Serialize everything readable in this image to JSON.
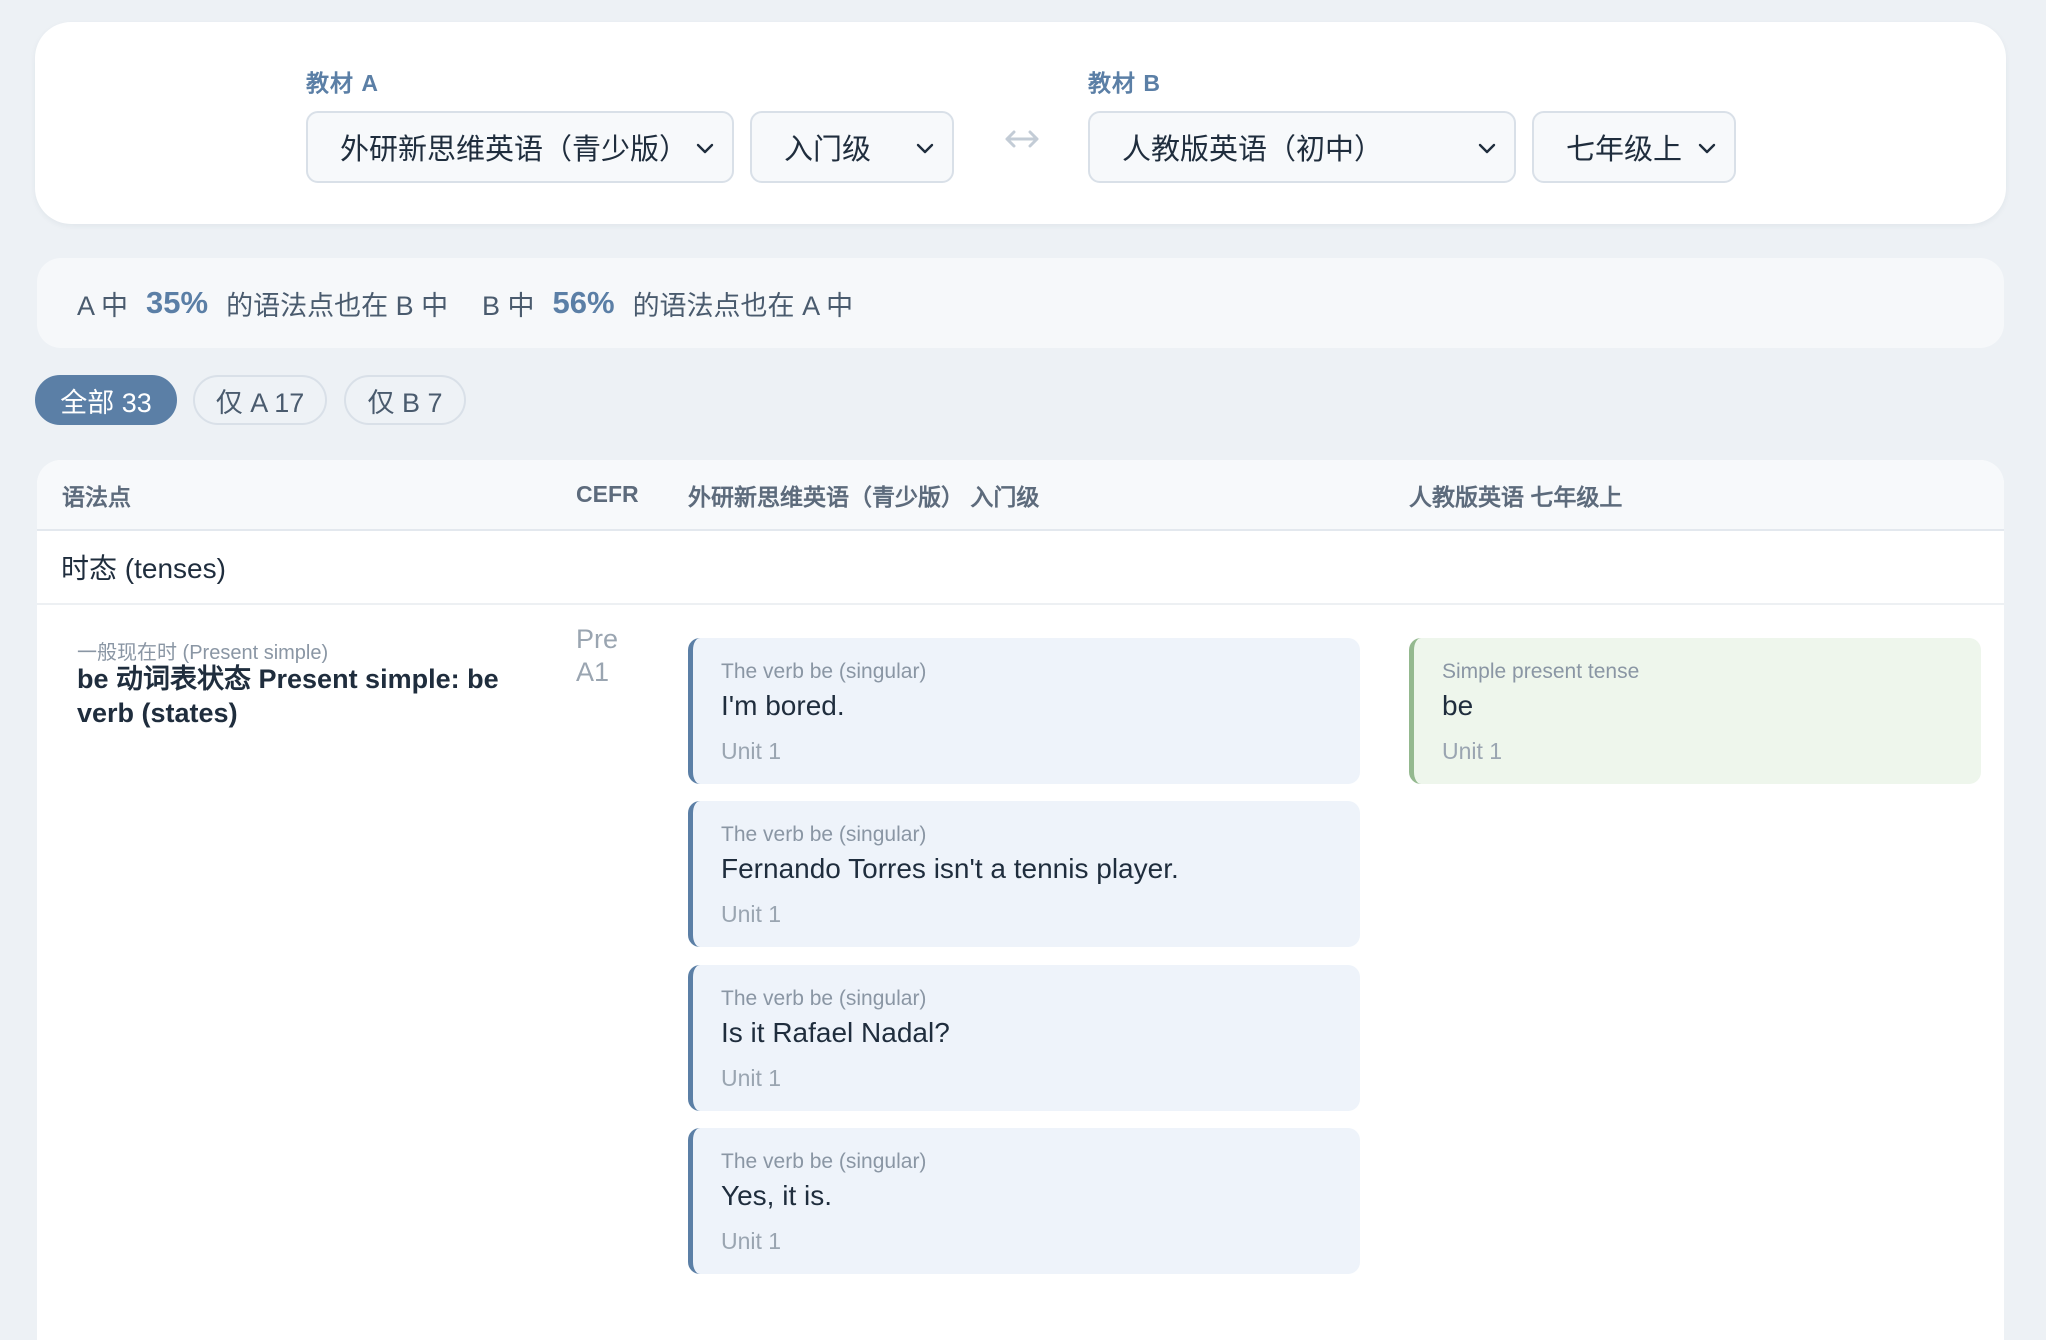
{
  "selectors": {
    "textbook_a": {
      "label": "教材 A",
      "book": "外研新思维英语（青少版）",
      "level": "入门级"
    },
    "textbook_b": {
      "label": "教材 B",
      "book": "人教版英语（初中）",
      "level": "七年级上"
    },
    "swap_icon": "swap-horizontal-icon"
  },
  "overlap": {
    "a_prefix": "A 中",
    "a_pct": "35%",
    "a_suffix": "的语法点也在 B 中",
    "b_prefix": "B 中",
    "b_pct": "56%",
    "b_suffix": "的语法点也在 A 中"
  },
  "filters": [
    {
      "label": "全部 33",
      "active": true
    },
    {
      "label": "仅 A 17",
      "active": false
    },
    {
      "label": "仅 B 7",
      "active": false
    }
  ],
  "table": {
    "headers": {
      "grammar_point": "语法点",
      "cefr": "CEFR",
      "col_a": "外研新思维英语（青少版） 入门级",
      "col_b": "人教版英语 七年级上"
    },
    "group": {
      "title": "时态 (tenses)",
      "rows": [
        {
          "sub": "一般现在时 (Present simple)",
          "main": "be 动词表状态 Present simple: be verb (states)",
          "cefr": "Pre A1",
          "a_examples": [
            {
              "category": "The verb be (singular)",
              "text": "I'm bored.",
              "unit": "Unit 1"
            },
            {
              "category": "The verb be (singular)",
              "text": "Fernando Torres isn't a tennis player.",
              "unit": "Unit 1"
            },
            {
              "category": "The verb be (singular)",
              "text": "Is it Rafael Nadal?",
              "unit": "Unit 1"
            },
            {
              "category": "The verb be (singular)",
              "text": "Yes, it is.",
              "unit": "Unit 1"
            }
          ],
          "b_examples": [
            {
              "category": "Simple present tense",
              "text": "be",
              "unit": "Unit 1"
            }
          ]
        }
      ]
    }
  },
  "colors": {
    "accent": "#5b7fa6",
    "background": "#edf1f5",
    "card_a": "#eef3fa",
    "card_b": "#eef6ec",
    "card_b_border": "#94b98f"
  }
}
